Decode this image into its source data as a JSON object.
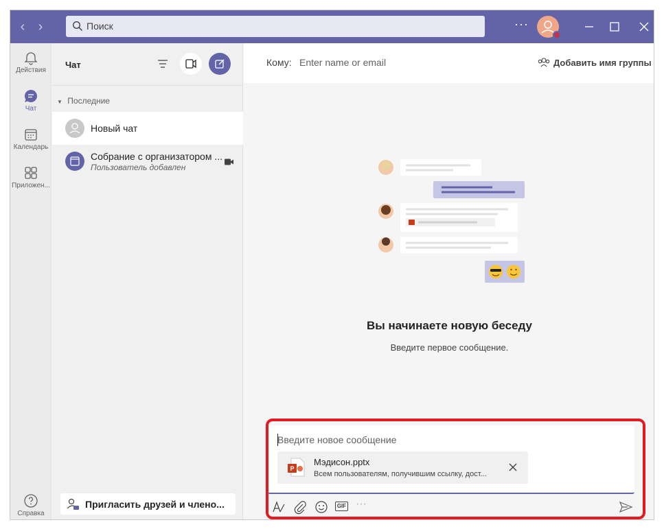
{
  "titlebar": {
    "search_placeholder": "Поиск",
    "more_label": "···",
    "accent_color": "#6264a7"
  },
  "rail": {
    "items": [
      {
        "label": "Действия",
        "icon": "bell-icon"
      },
      {
        "label": "Чат",
        "icon": "chat-icon",
        "active": true
      },
      {
        "label": "Календарь",
        "icon": "calendar-icon"
      },
      {
        "label": "Приложен...",
        "icon": "apps-icon"
      }
    ],
    "help_label": "Справка"
  },
  "chatlist": {
    "title": "Чат",
    "section_label": "Последние",
    "items": [
      {
        "name": "Новый чат",
        "subtitle": ""
      },
      {
        "name": "Собрание с организатором ...",
        "subtitle": "Пользователь добавлен"
      }
    ],
    "invite_label": "Пригласить друзей и члено..."
  },
  "main": {
    "to_label": "Кому:",
    "to_placeholder": "Enter name or email",
    "add_group_label": "Добавить имя группы",
    "heading": "Вы начинаете новую беседу",
    "subheading": "Введите первое сообщение."
  },
  "compose": {
    "placeholder": "Введите новое сообщение",
    "attachment": {
      "name": "Мэдисон.pptx",
      "description": "Всем пользователям, получившим ссылку, дост..."
    },
    "gif_label": "GIF"
  }
}
